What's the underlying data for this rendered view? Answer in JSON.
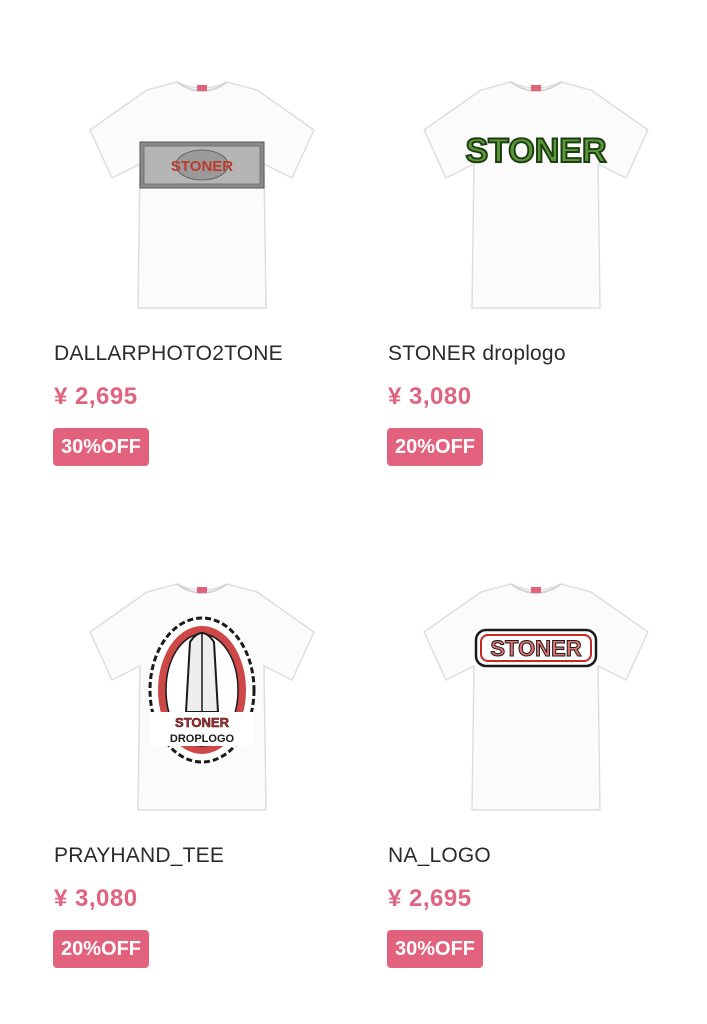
{
  "products": [
    {
      "name": "DALLARPHOTO2TONE",
      "price": "¥ 2,695",
      "discount": "30%OFF",
      "print": "dollar-bill-photo"
    },
    {
      "name": "STONER droplogo",
      "price": "¥ 3,080",
      "discount": "20%OFF",
      "print": "stoner-arched-logo-green",
      "print_text": "STONER"
    },
    {
      "name": "PRAYHAND_TEE",
      "price": "¥ 3,080",
      "discount": "20%OFF",
      "print": "praying-hands-graphic",
      "print_text": "STONER DROPLOGO"
    },
    {
      "name": "NA_LOGO",
      "price": "¥ 2,695",
      "discount": "30%OFF",
      "print": "stoner-boxed-logo-red",
      "print_text": "STONER"
    }
  ],
  "colors": {
    "price": "#e0637f",
    "badge": "#e2617c",
    "shirt": "#fbfbfb",
    "logo_green": "#5a9a3a"
  }
}
